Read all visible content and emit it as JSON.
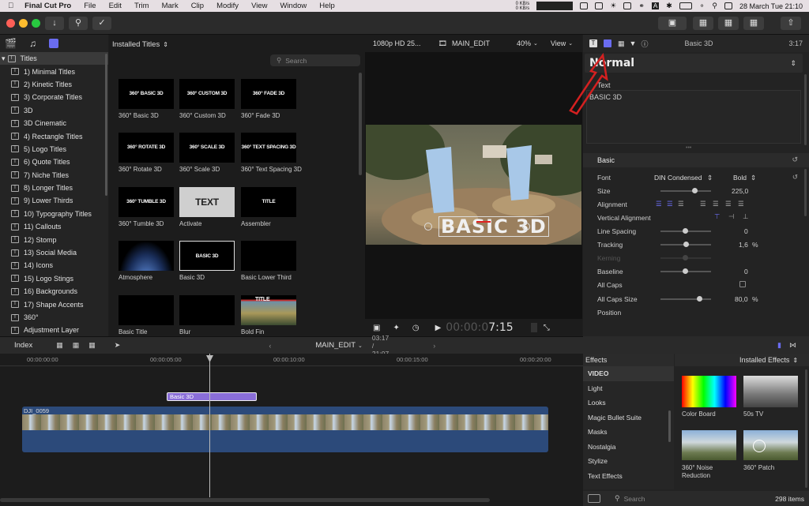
{
  "menubar": {
    "app_name": "Final Cut Pro",
    "menus": [
      "File",
      "Edit",
      "Trim",
      "Mark",
      "Clip",
      "Modify",
      "View",
      "Window",
      "Help"
    ],
    "net_up": "0 KB/s",
    "net_down": "0 KB/s",
    "datetime": "28 March Tue  21:10"
  },
  "library": {
    "items": [
      "Titles",
      "1) Minimal Titles",
      "2) Kinetic Titles",
      "3) Corporate Titles",
      "3D",
      "3D Cinematic",
      "4) Rectangle Titles",
      "5) Logo Titles",
      "6) Quote Titles",
      "7) Niche Titles",
      "8) Longer Titles",
      "9) Lower Thirds",
      "10) Typography Titles",
      "11) Callouts",
      "12) Stomp",
      "13) Social Media",
      "14) Icons",
      "15) Logo Stings",
      "16) Backgrounds",
      "17) Shape Accents",
      "360°",
      "Adjustment Layer"
    ]
  },
  "browser": {
    "header": "Installed Titles",
    "search_placeholder": "Search",
    "tiles": [
      {
        "thumb": "360° BASIC 3D",
        "caption": "360° Basic 3D"
      },
      {
        "thumb": "360° CUSTOM 3D",
        "caption": "360° Custom 3D"
      },
      {
        "thumb": "360° FADE 3D",
        "caption": "360° Fade 3D"
      },
      {
        "thumb": "360° ROTATE 3D",
        "caption": "360° Rotate 3D"
      },
      {
        "thumb": "360° SCALE 3D",
        "caption": "360° Scale 3D"
      },
      {
        "thumb": "360° TEXT SPACING 3D",
        "caption": "360° Text Spacing 3D"
      },
      {
        "thumb": "360° TUMBLE 3D",
        "caption": "360° Tumble 3D"
      },
      {
        "thumb": "TEXT",
        "caption": "Activate"
      },
      {
        "thumb": "TITLE",
        "caption": "Assembler"
      },
      {
        "thumb": "",
        "caption": "Atmosphere"
      },
      {
        "thumb": "BASIC 3D",
        "caption": "Basic 3D"
      },
      {
        "thumb": "",
        "caption": "Basic Lower Third"
      },
      {
        "thumb": "",
        "caption": "Basic Title"
      },
      {
        "thumb": "",
        "caption": "Blur"
      },
      {
        "thumb": "TITLE",
        "caption": "Bold Fin"
      }
    ]
  },
  "viewer": {
    "format": "1080p HD 25...",
    "project": "MAIN_EDIT",
    "zoom": "40%",
    "view_label": "View",
    "overlay_text": "BASIC 3D",
    "timecode_dim": "00:00:0",
    "timecode": "7:15"
  },
  "inspector": {
    "clip_name": "Basic 3D",
    "duration": "3:17",
    "preset": "Normal",
    "text_label": "Text",
    "text_value": "BASIC 3D",
    "section": "Basic",
    "font_label": "Font",
    "font_family": "DIN Condensed",
    "font_weight": "Bold",
    "size_label": "Size",
    "size_value": "225,0",
    "size_level": 0.62,
    "alignment_label": "Alignment",
    "valign_label": "Vertical Alignment",
    "line_spacing_label": "Line Spacing",
    "line_spacing_value": "0",
    "tracking_label": "Tracking",
    "tracking_value": "1,6",
    "kerning_label": "Kerning",
    "baseline_label": "Baseline",
    "baseline_value": "0",
    "allcaps_label": "All Caps",
    "allcaps_size_label": "All Caps Size",
    "allcaps_size_value": "80,0",
    "percent": "%",
    "position_label": "Position"
  },
  "timeline_bar": {
    "index": "Index",
    "project": "MAIN_EDIT",
    "position": "03:17 / 21:07"
  },
  "timeline": {
    "ruler": [
      "00:00:00:00",
      "00:00:05:00",
      "00:00:10:00",
      "00:00:15:00",
      "00:00:20:00"
    ],
    "title_clip": "Basic 3D",
    "video_clip": "DJI_0059"
  },
  "effects": {
    "header": "Effects",
    "installed": "Installed Effects",
    "categories": [
      "VIDEO",
      "Light",
      "Looks",
      "Magic Bullet Suite",
      "Masks",
      "Nostalgia",
      "Stylize",
      "Text Effects"
    ],
    "tiles": [
      "Color Board",
      "50s TV",
      "360° Noise Reduction",
      "360° Patch"
    ],
    "search_placeholder": "Search",
    "count": "298 items"
  },
  "colors": {
    "accent": "#6a6cf0",
    "title_clip": "#8a6ed8",
    "video_clip": "#2c4a7a",
    "annotation": "#d42020"
  }
}
